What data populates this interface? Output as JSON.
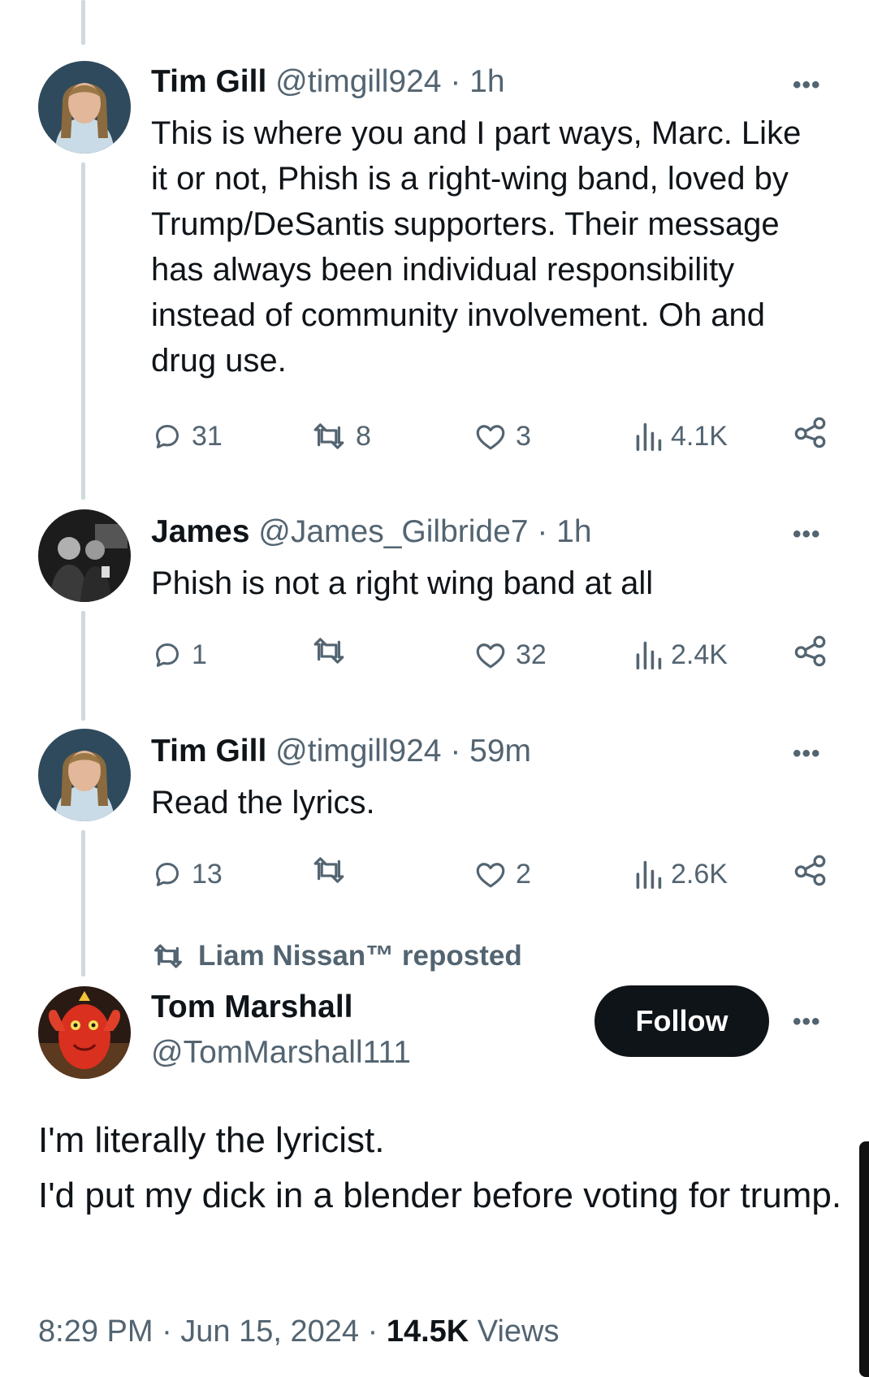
{
  "tweets": [
    {
      "name": "Tim Gill",
      "handle": "@timgill924",
      "time": "· 1h",
      "text": "This is where you and I part ways, Marc. Like it or not, Phish is a right-wing band, loved by Trump/DeSantis supporters. Their message has always been individual responsibility instead of community involvement. Oh and drug use.",
      "replies": "31",
      "reposts": "8",
      "likes": "3",
      "views": "4.1K"
    },
    {
      "name": "James",
      "handle": "@James_Gilbride7",
      "time": "· 1h",
      "text": "Phish is not a right wing band at all",
      "replies": "1",
      "reposts": "",
      "likes": "32",
      "views": "2.4K"
    },
    {
      "name": "Tim Gill",
      "handle": "@timgill924",
      "time": "· 59m",
      "text": "Read the lyrics.",
      "replies": "13",
      "reposts": "",
      "likes": "2",
      "views": "2.6K"
    }
  ],
  "repost_note": "Liam Nissan™ reposted",
  "main_tweet": {
    "name": "Tom Marshall",
    "handle": "@TomMarshall111",
    "follow_label": "Follow",
    "line1": "I'm literally the lyricist.",
    "line2": "I'd put my dick in a blender before voting for trump.",
    "time": "8:29 PM · Jun 15, 2024 ·",
    "views_count": "14.5K",
    "views_label": "Views"
  },
  "more_label": "•••",
  "colors": {
    "text": "#0f1419",
    "secondary": "#536471",
    "thread": "#cfd9de",
    "button": "#0f1419"
  }
}
